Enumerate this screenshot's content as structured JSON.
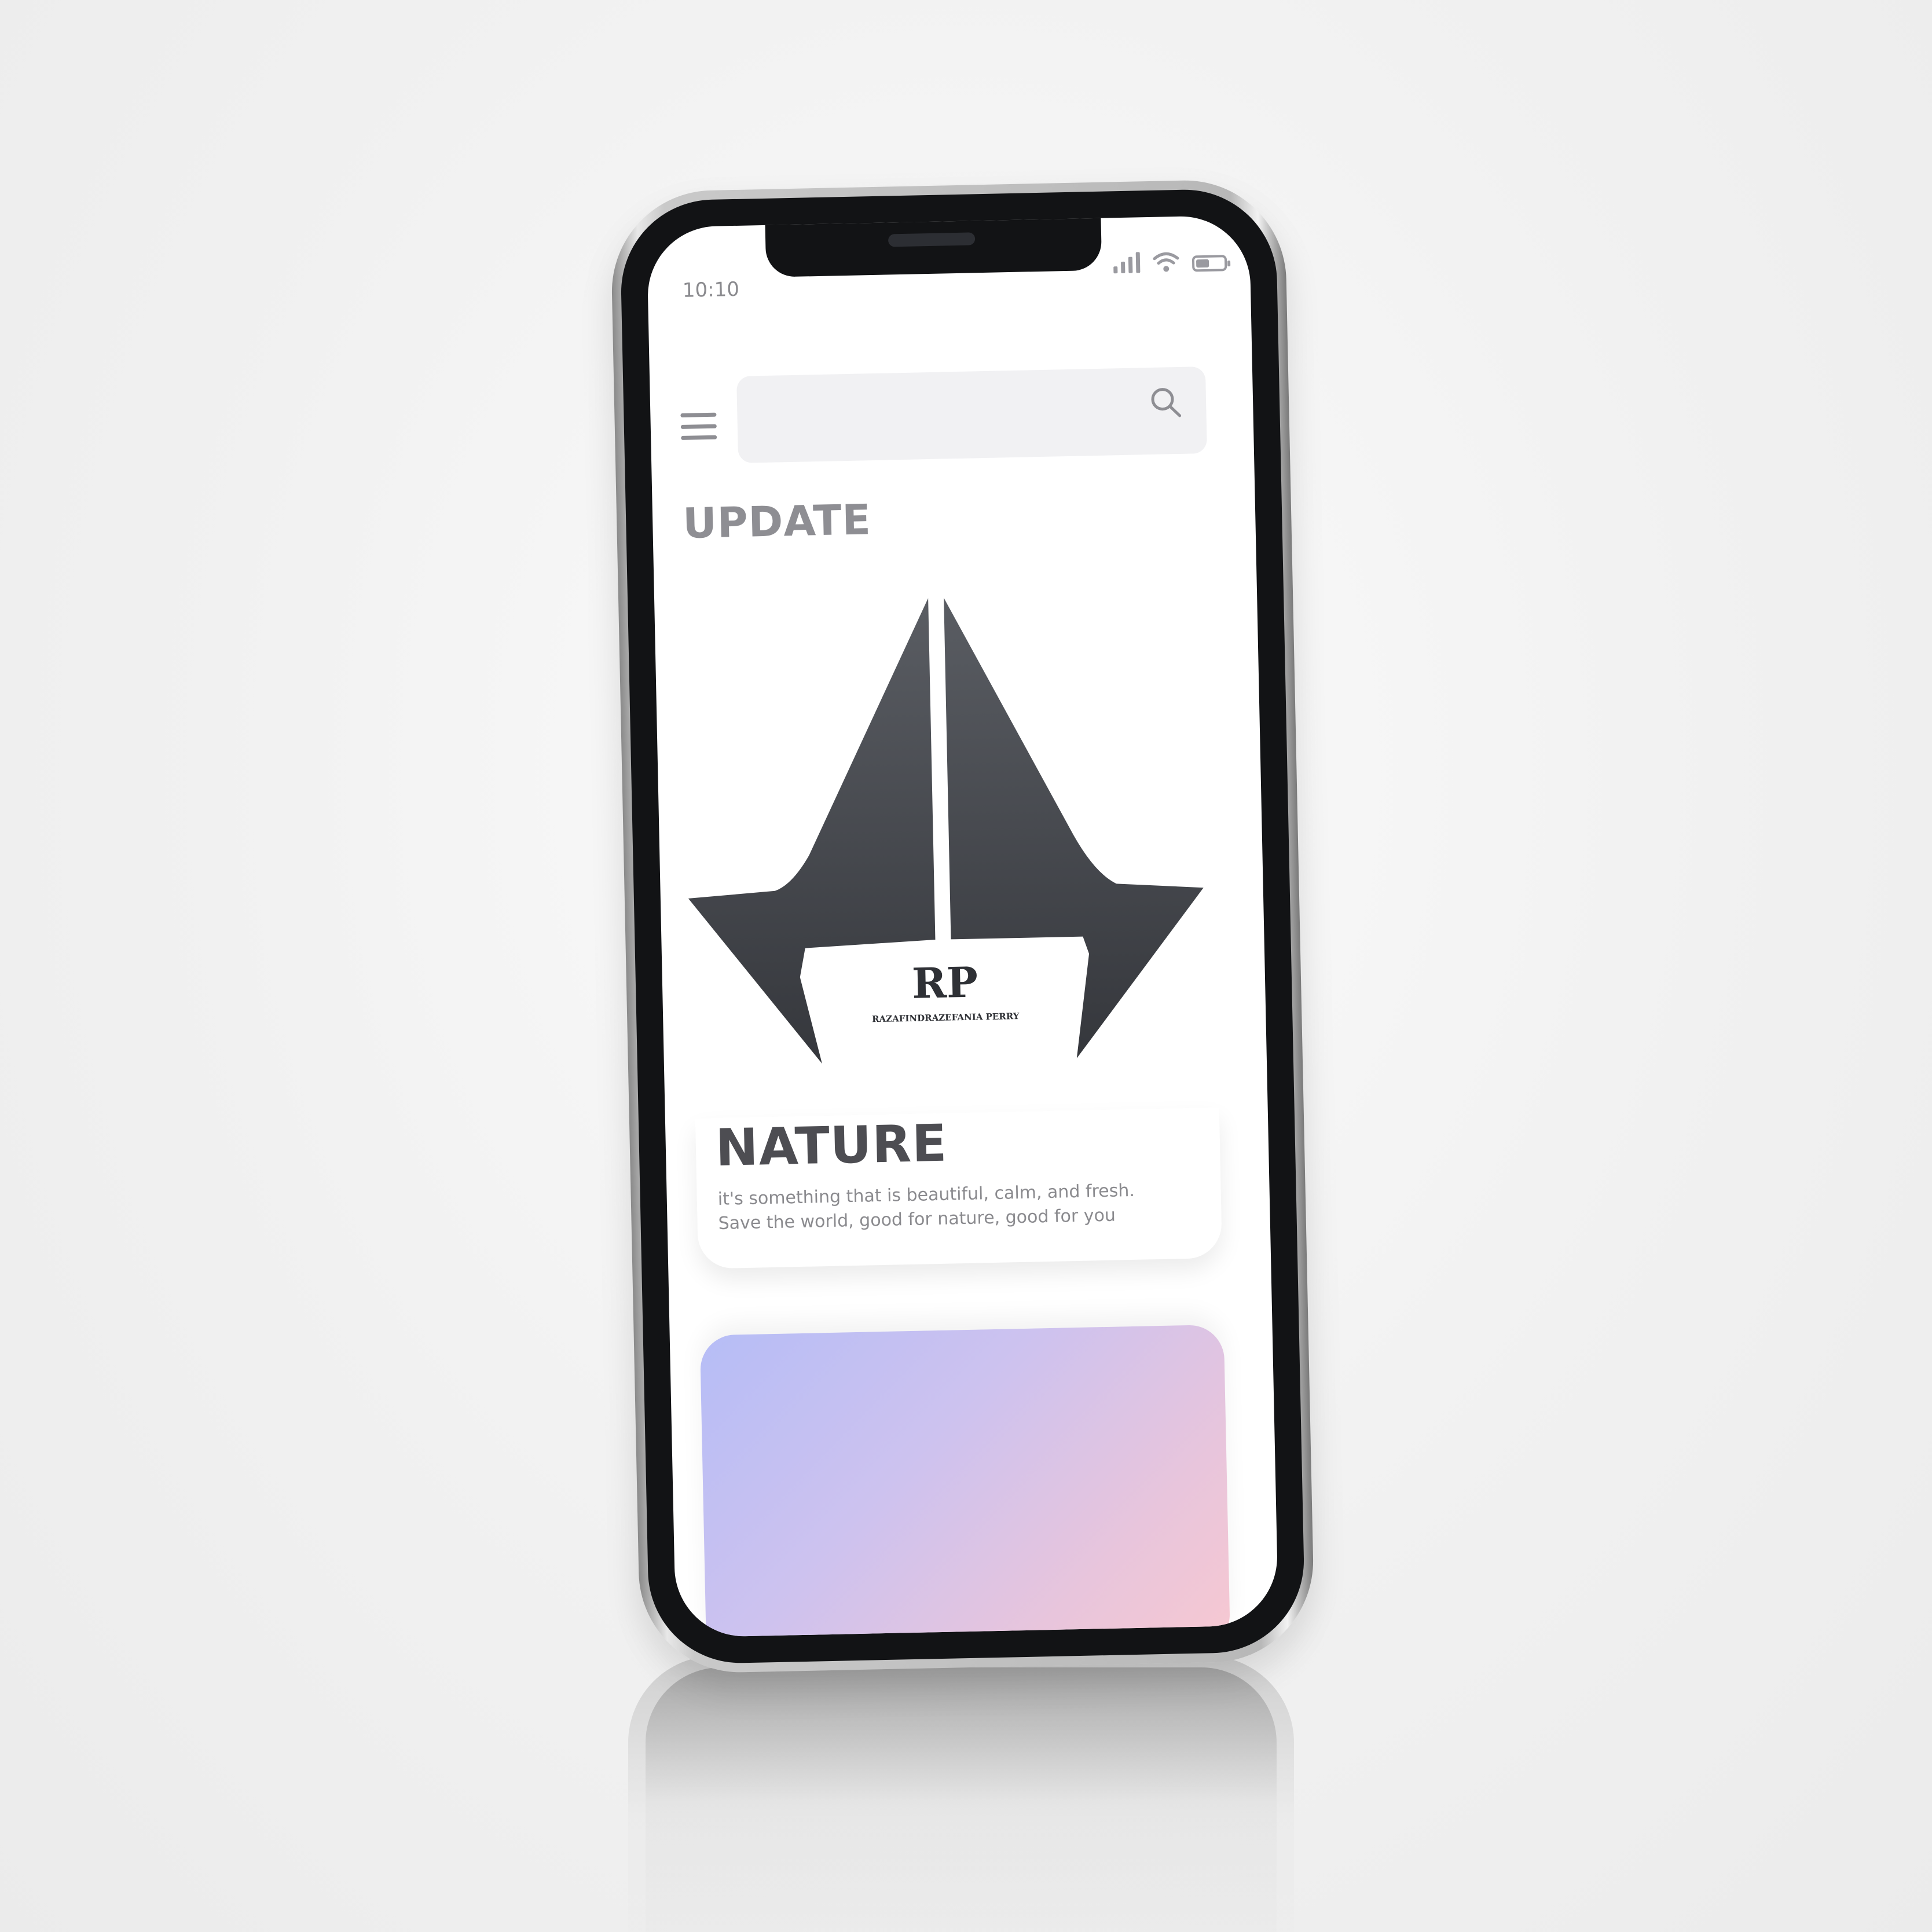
{
  "status_bar": {
    "time": "10:10",
    "icons": [
      "signal-icon",
      "wifi-icon",
      "battery-icon"
    ]
  },
  "header": {
    "menu_icon": "menu-icon",
    "search": {
      "placeholder": "",
      "value": "",
      "icon": "search-icon"
    }
  },
  "section": {
    "title": "UPDATE"
  },
  "logo": {
    "initials": "RP",
    "name": "RAZAFINDRAZEFANIA PERRY",
    "color": "#45474d"
  },
  "nature_card": {
    "title": "NATURE",
    "line1": "it's something that is beautiful, calm, and fresh.",
    "line2": "Save the world, good for nature, good for you"
  },
  "gradient_card": {
    "colors": [
      "#b6bdf6",
      "#cdc2ef",
      "#e8c5dc",
      "#f7c8d1"
    ]
  },
  "colors": {
    "text_muted": "#8e8e93",
    "text_dark": "#4d4d52",
    "search_bg": "#f1f1f3"
  }
}
